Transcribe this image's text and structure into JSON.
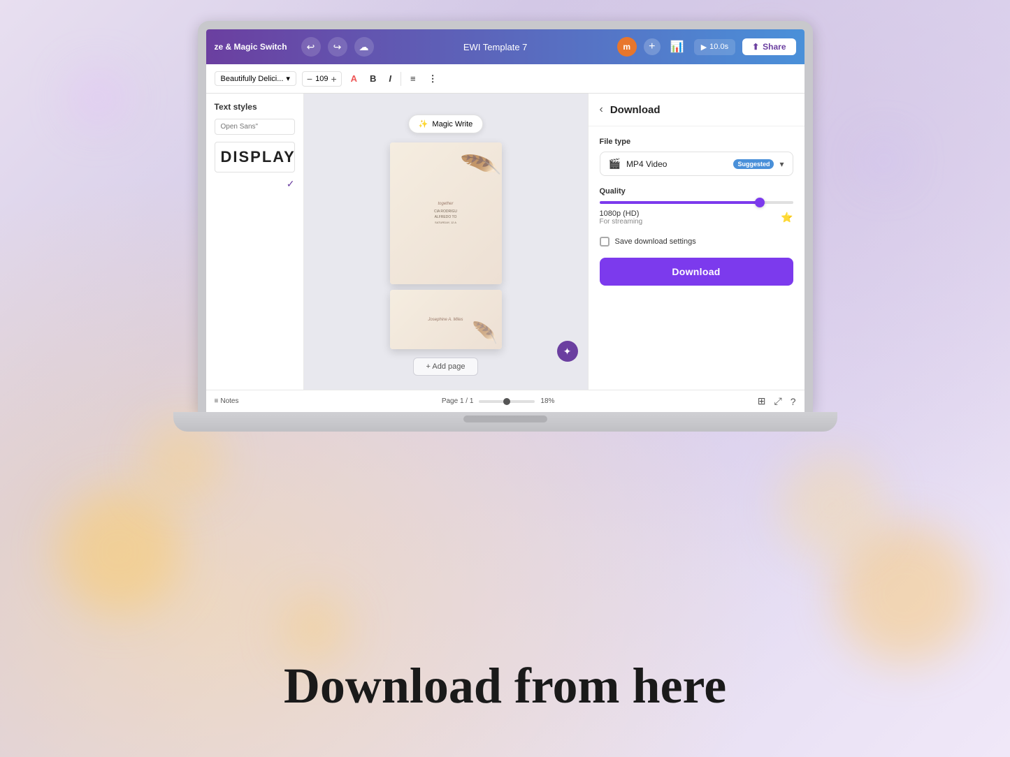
{
  "background": {
    "bokeh_circles": 8
  },
  "bottom_text": "Download from here",
  "laptop": {
    "top_bar": {
      "app_name": "ze & Magic Switch",
      "title": "EWI Template 7",
      "avatar_label": "m",
      "time_label": "10.0s",
      "share_label": "Share"
    },
    "toolbar": {
      "font_family": "Beautifully Delici...",
      "font_size": "109",
      "bold_label": "B",
      "italic_label": "I"
    },
    "sidebar": {
      "title": "Text styles",
      "font_placeholder": "Open Sans\"",
      "style_display": "DISPLAY"
    },
    "canvas": {
      "magic_write_label": "Magic Write",
      "add_page_label": "+ Add page"
    },
    "download_panel": {
      "title": "Download",
      "file_type_label": "File type",
      "file_type_value": "MP4 Video",
      "suggested_label": "Suggested",
      "quality_label": "Quality",
      "quality_value": "1080p (HD)",
      "quality_sub": "For streaming",
      "quality_slider_pct": 85,
      "save_settings_label": "Save download settings",
      "download_btn_label": "Download"
    },
    "status_bar": {
      "notes_label": "Notes",
      "page_label": "Page 1 / 1",
      "zoom_label": "18%"
    }
  }
}
